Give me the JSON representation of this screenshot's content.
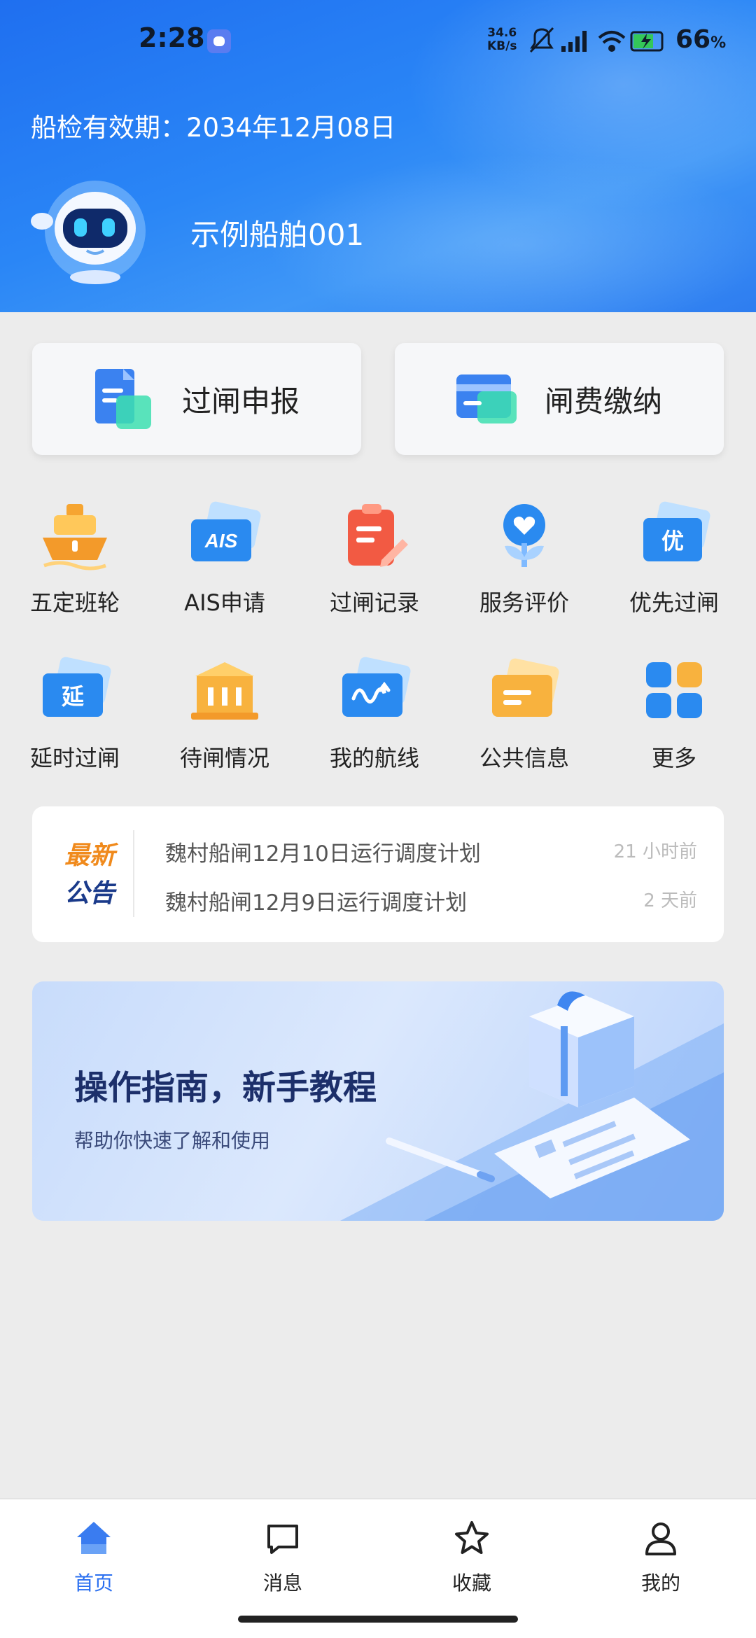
{
  "status_bar": {
    "time": "2:28",
    "net_speed_value": "34.6",
    "net_speed_unit": "KB/s",
    "battery_value": "66",
    "battery_unit": "%"
  },
  "header": {
    "validity": "船检有效期：2034年12月08日",
    "ship_name": "示例船舶001"
  },
  "top_actions": [
    {
      "label": "过闸申报",
      "icon": "document-icon"
    },
    {
      "label": "闸费缴纳",
      "icon": "card-icon"
    }
  ],
  "menu": [
    {
      "label": "五定班轮",
      "icon": "ship-icon"
    },
    {
      "label": "AIS申请",
      "icon": "ais-icon",
      "icon_text": "AIS"
    },
    {
      "label": "过闸记录",
      "icon": "clipboard-icon"
    },
    {
      "label": "服务评价",
      "icon": "heart-flower-icon"
    },
    {
      "label": "优先过闸",
      "icon": "priority-icon",
      "icon_text": "优"
    },
    {
      "label": "延时过闸",
      "icon": "delay-icon",
      "icon_text": "延"
    },
    {
      "label": "待闸情况",
      "icon": "lock-gate-icon"
    },
    {
      "label": "我的航线",
      "icon": "route-icon"
    },
    {
      "label": "公共信息",
      "icon": "info-folder-icon"
    },
    {
      "label": "更多",
      "icon": "more-grid-icon"
    }
  ],
  "notice": {
    "badge_line1": "最新",
    "badge_line2": "公告",
    "items": [
      {
        "title": "魏村船闸12月10日运行调度计划",
        "time": "21 小时前"
      },
      {
        "title": "魏村船闸12月9日运行调度计划",
        "time": "2 天前"
      }
    ]
  },
  "banner": {
    "title": "操作指南，新手教程",
    "subtitle": "帮助你快速了解和使用"
  },
  "tabs": [
    {
      "label": "首页",
      "icon": "home-icon",
      "active": true
    },
    {
      "label": "消息",
      "icon": "message-icon",
      "active": false
    },
    {
      "label": "收藏",
      "icon": "star-icon",
      "active": false
    },
    {
      "label": "我的",
      "icon": "user-icon",
      "active": false
    }
  ],
  "colors": {
    "accent": "#2a6ff0",
    "header_blue": "#2a86f6",
    "notice_orange": "#f08a1c",
    "notice_navy": "#1a3a8a"
  }
}
